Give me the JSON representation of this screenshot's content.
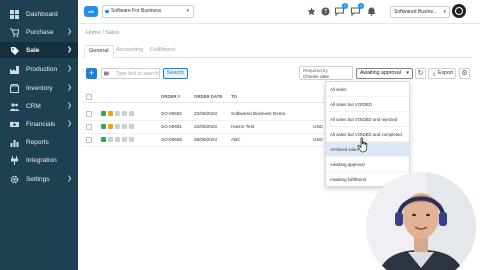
{
  "sidebar": {
    "items": [
      {
        "label": "Dashboard",
        "icon": "dashboard-icon",
        "chevron": false
      },
      {
        "label": "Purchase",
        "icon": "cart-icon",
        "chevron": true
      },
      {
        "label": "Sale",
        "icon": "tag-icon",
        "chevron": true,
        "active": true
      },
      {
        "label": "Production",
        "icon": "factory-icon",
        "chevron": true
      },
      {
        "label": "Inventory",
        "icon": "box-icon",
        "chevron": true
      },
      {
        "label": "CRM",
        "icon": "people-icon",
        "chevron": true
      },
      {
        "label": "Financials",
        "icon": "money-icon",
        "chevron": true
      },
      {
        "label": "Reports",
        "icon": "chart-icon",
        "chevron": false
      },
      {
        "label": "Integration",
        "icon": "plug-icon",
        "chevron": false
      },
      {
        "label": "Settings",
        "icon": "gear-icon",
        "chevron": true
      }
    ]
  },
  "topbar": {
    "org_selector": "Software For Business",
    "account_selector": "Softwared Busine...",
    "notification_badges": [
      "1",
      "1"
    ]
  },
  "breadcrumb": "Home / Sales",
  "tabs": [
    "General",
    "Accounting",
    "Fulfillment"
  ],
  "toolbar": {
    "search_placeholder": "Type text to search",
    "search_button": "Search",
    "date_hint": "Required by",
    "date_placeholder": "Choose date",
    "status_value": "Awaiting approval",
    "export_label": "Export"
  },
  "table": {
    "columns": [
      "ORDER #",
      "ORDER DATE",
      "TO"
    ],
    "rows": [
      {
        "order": "SO-00682",
        "date": "22/09/2023",
        "to": "Softwared Business Demo",
        "extra": ""
      },
      {
        "order": "SO-00681",
        "date": "22/09/2023",
        "to": "Hanno Test",
        "extra": "USD"
      },
      {
        "order": "SO-00655",
        "date": "09/09/2023",
        "to": "ABC",
        "extra": "USD"
      }
    ]
  },
  "status_dropdown": {
    "options": [
      "All sales",
      "All sales but VOIDED",
      "All sales but VOIDED and rejected",
      "All sales but VOIDED and completed",
      "Archived sales",
      "Awaiting approval",
      "Awaiting fulfillment"
    ],
    "hovered_index": 4
  },
  "colors": {
    "sidebar_bg": "#1f3f53",
    "accent": "#1f7fd1",
    "hover_bg": "#dbe9f6"
  }
}
